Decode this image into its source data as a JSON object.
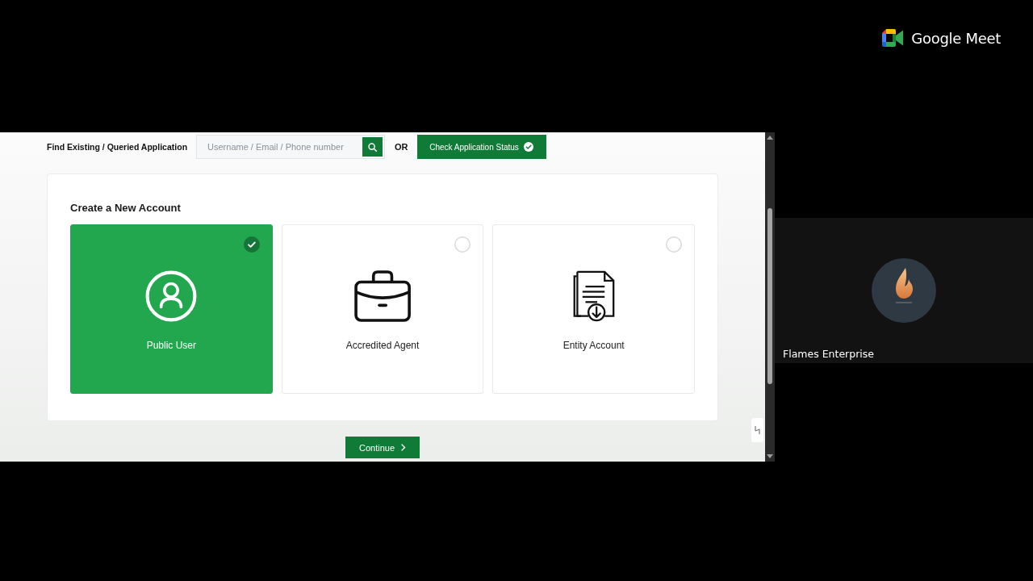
{
  "meeting": {
    "app_name": "Google Meet",
    "participant": {
      "name": "Flames Enterprise"
    }
  },
  "shared_screen": {
    "search_bar": {
      "label": "Find Existing / Queried Application",
      "placeholder": "Username / Email / Phone number",
      "separator": "OR",
      "status_button": "Check Application Status"
    },
    "account_panel": {
      "title": "Create a New Account",
      "options": [
        {
          "kind": "user",
          "label": "Public User",
          "selected": true
        },
        {
          "kind": "briefcase",
          "label": "Accredited Agent",
          "selected": false
        },
        {
          "kind": "document",
          "label": "Entity Account",
          "selected": false
        }
      ]
    },
    "continue_button": "Continue"
  }
}
